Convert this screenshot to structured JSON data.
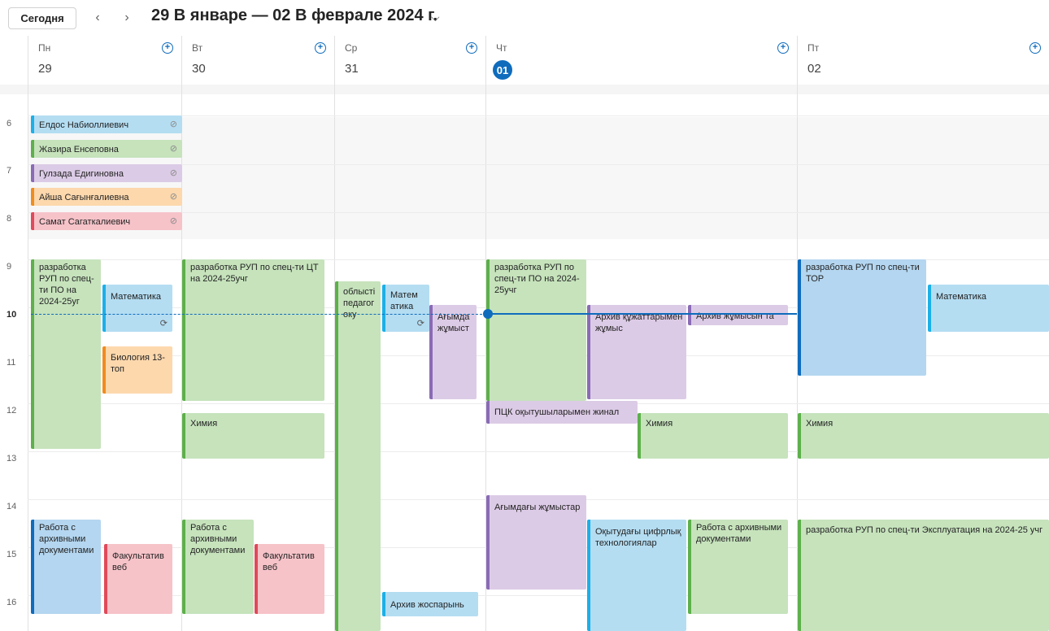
{
  "toolbar": {
    "today_label": "Сегодня",
    "prev_icon": "‹",
    "next_icon": "›",
    "range_title": "29 В январе — 02 В феврале 2024 г.",
    "range_chevron": "⌵"
  },
  "days": [
    {
      "name": "Пн",
      "num": "29"
    },
    {
      "name": "Вт",
      "num": "30"
    },
    {
      "name": "Ср",
      "num": "31"
    },
    {
      "name": "Чт",
      "num": "01"
    },
    {
      "name": "Пт",
      "num": "02"
    }
  ],
  "hours": [
    "6",
    "7",
    "8",
    "9",
    "10",
    "11",
    "12",
    "13",
    "14",
    "15",
    "16"
  ],
  "events": {
    "mon_person1": "Елдос Набиоллиевич",
    "mon_person2": "Жазира Енсеповна",
    "mon_person3": "Гулзада Едигиновна",
    "mon_person4": "Айша Сағынғалиевна",
    "mon_person5": "Самат Сагаткалиевич",
    "mon_rup": "разработка РУП по спец-ти ПО на 2024-25уг",
    "mon_math": "Математика",
    "mon_bio": "Биология 13-топ",
    "mon_archive": "Работа с архивными документами",
    "mon_fakult": "Факультатив веб",
    "tue_rup": "разработка РУП по спец-ти ЦТ на 2024-25учг",
    "tue_chem": "Химия",
    "tue_archive": "Работа с архивными документами",
    "tue_fakult": "Факультатив веб",
    "wed_obl": "облысті педагог оку",
    "wed_math": "Матем атика",
    "wed_agym": "Ағымда жұмыст",
    "wed_archive": "Архив жоспарынь",
    "thu_rup": "разработка РУП по спец-ти ПО на 2024-25учг",
    "thu_arch_doc": "Архив құжаттарымен жұмыс",
    "thu_arch_work": "Архив жұмысын та",
    "thu_pck": "ПЦК оқытушыларымен жинал",
    "thu_chem": "Химия",
    "thu_agym": "Ағымдағы жұмыстар",
    "thu_okyt": "Оқытудағы цифрлық технологиялар",
    "thu_archive": "Работа с архивными документами",
    "fri_rup": "разработка РУП по спец-ти ТОР",
    "fri_math": "Математика",
    "fri_chem": "Химия",
    "fri_rup2": "разработка РУП по спец-ти Эксплуатация на 2024-25 учг"
  },
  "colors": {
    "accent": "#0f6cbd",
    "green": "#5db04b",
    "blue": "#1bb0e8",
    "purple": "#8a6bb5",
    "orange": "#f08c1e",
    "red": "#e04a5a"
  }
}
